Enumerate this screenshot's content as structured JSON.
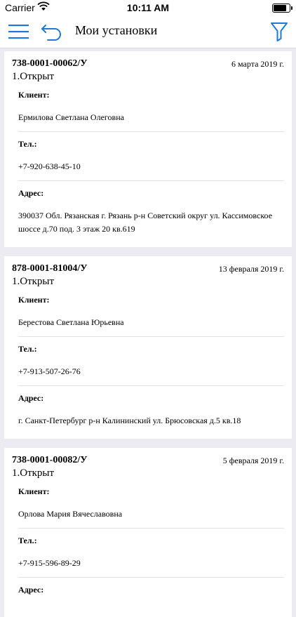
{
  "status_bar": {
    "carrier": "Carrier",
    "time": "10:11 AM",
    "battery_level": 0.9
  },
  "nav": {
    "title": "Мои установки"
  },
  "icons": {
    "menu": "hamburger-menu-icon",
    "back": "undo-arrow-icon",
    "filter": "funnel-icon"
  },
  "colors": {
    "accent": "#1e7ad6",
    "background": "#ecebf1"
  },
  "orders": [
    {
      "number": "738-0001-00062/У",
      "date": "6 марта 2019 г.",
      "status": "1.Открыт",
      "client_label": "Клиент:",
      "client": "Ермилова Светлана Олеговна",
      "phone_label": "Тел.:",
      "phone": "+7-920-638-45-10",
      "address_label": "Адрес:",
      "address": "390037 Обл. Рязанская г. Рязань р-н Советский округ ул. Кассимовское шоссе д.70 под. 3 этаж 20 кв.619"
    },
    {
      "number": "878-0001-81004/У",
      "date": "13 февраля 2019 г.",
      "status": "1.Открыт",
      "client_label": "Клиент:",
      "client": "Берестова Светлана Юрьевна",
      "phone_label": "Тел.:",
      "phone": "+7-913-507-26-76",
      "address_label": "Адрес:",
      "address": "г. Санкт-Петербург р-н Калининский ул. Брюсовская д.5 кв.18"
    },
    {
      "number": "738-0001-00082/У",
      "date": "5 февраля 2019 г.",
      "status": "1.Открыт",
      "client_label": "Клиент:",
      "client": "Орлова Мария Вячеславовна",
      "phone_label": "Тел.:",
      "phone": "+7-915-596-89-29",
      "address_label": "Адрес:",
      "address": ""
    }
  ]
}
